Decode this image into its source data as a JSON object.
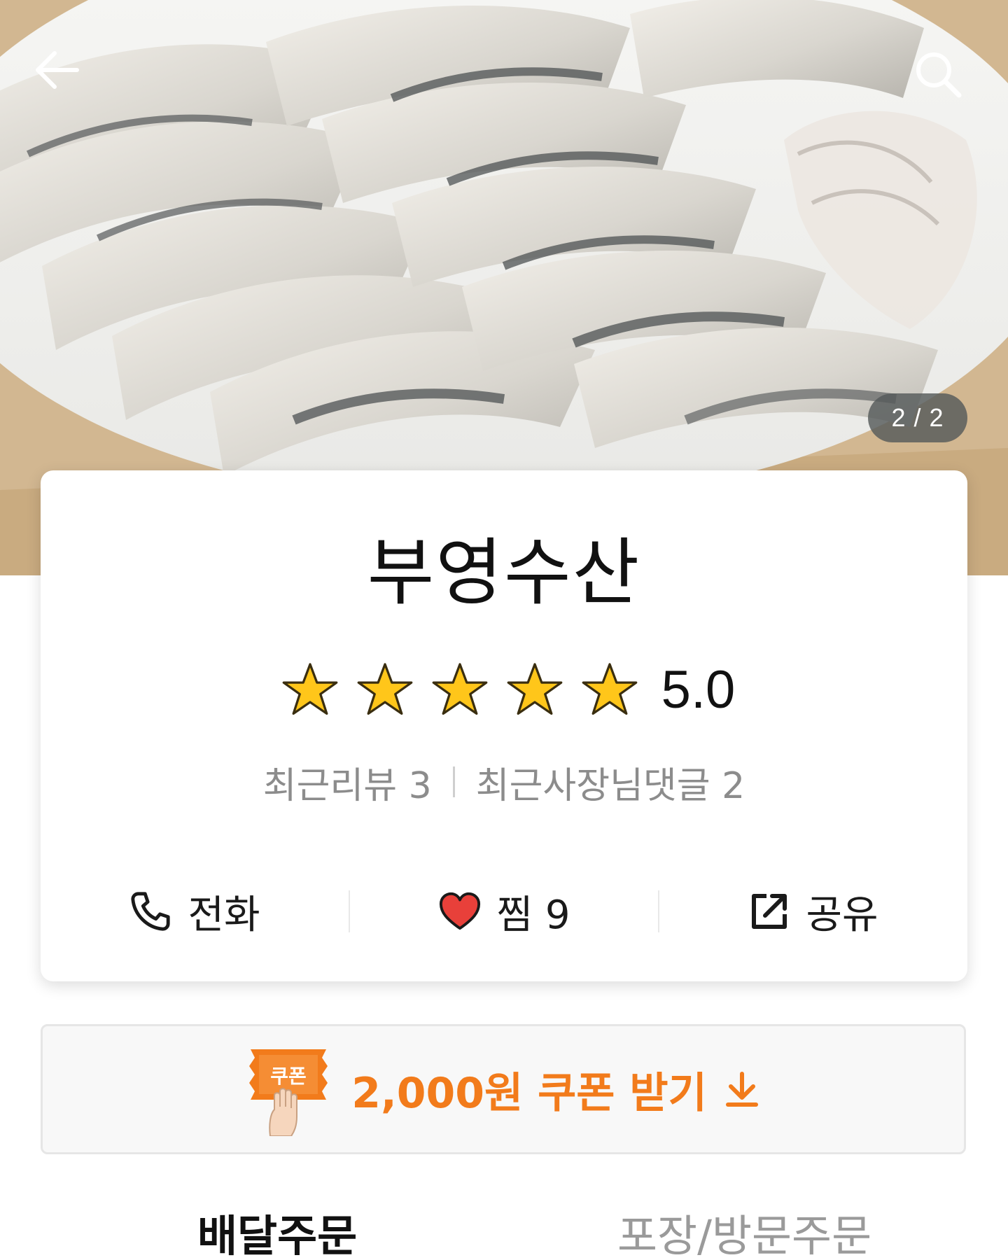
{
  "hero": {
    "image_description": "",
    "pager": "2 / 2"
  },
  "store": {
    "name": "부영수산",
    "rating_stars": 5,
    "rating_value": "5.0",
    "recent_reviews": "최근리뷰 3",
    "recent_owner_replies": "최근사장님댓글 2"
  },
  "actions": {
    "call_label": "전화",
    "favorite_label": "찜 9",
    "share_label": "공유"
  },
  "coupon": {
    "badge_label": "쿠폰",
    "text": "2,000원 쿠폰 받기"
  },
  "tabs": [
    {
      "label": "배달주문"
    },
    {
      "label": "포장/방문주문"
    }
  ],
  "colors": {
    "accent_orange": "#f27b1b",
    "heart_red": "#e8403a",
    "star_yellow": "#ffc61a"
  },
  "icons": {
    "back": "arrow-left-icon",
    "search": "search-icon",
    "call": "phone-icon",
    "favorite": "heart-icon",
    "share": "share-icon",
    "coupon_download": "download-arrow-icon"
  }
}
